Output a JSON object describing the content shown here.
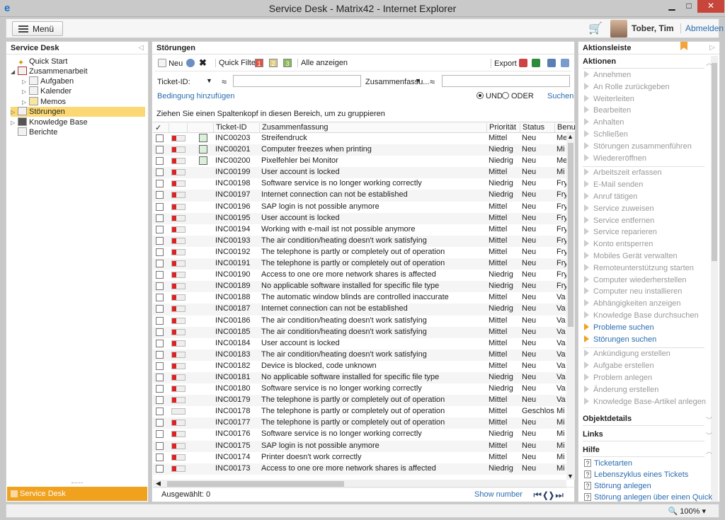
{
  "window": {
    "title": "Service Desk - Matrix42 - Internet Explorer"
  },
  "header": {
    "menu_label": "Menü",
    "user": "Tober, Tim",
    "logout": "Abmelden"
  },
  "left": {
    "title": "Service Desk",
    "tree": [
      "Quick Start",
      "Zusammenarbeit",
      "Aufgaben",
      "Kalender",
      "Memos",
      "Störungen",
      "Knowledge Base",
      "Berichte"
    ],
    "footer": "Service Desk"
  },
  "main": {
    "title": "Störungen",
    "toolbar": {
      "new": "Neu",
      "quick_filter": "Quick Filter",
      "q1": "1",
      "q2": "2",
      "q3": "3",
      "show_all": "Alle anzeigen",
      "export": "Export"
    },
    "filter": {
      "ticket_label": "Ticket-ID:",
      "approx1": "≈",
      "summary_label": "Zusammenfassu...",
      "approx2": "≈",
      "add_condition": "Bedingung hinzufügen",
      "and": "UND",
      "or": "ODER",
      "search": "Suchen"
    },
    "group_hint": "Ziehen Sie einen Spaltenkopf in diesen Bereich, um zu gruppieren",
    "columns": {
      "check": "✓",
      "ticket": "Ticket-ID",
      "summary": "Zusammenfassung",
      "priority": "Priorität",
      "status": "Status",
      "user": "Benut"
    },
    "rows": [
      {
        "id": "INC00203",
        "summary": "Streifendruck",
        "prio": "Mittel",
        "status": "Neu",
        "user": "Me",
        "note": true
      },
      {
        "id": "INC00201",
        "summary": "Computer freezes when printing",
        "prio": "Niedrig",
        "status": "Neu",
        "user": "Mi",
        "note": true
      },
      {
        "id": "INC00200",
        "summary": "Pixelfehler bei Monitor",
        "prio": "Niedrig",
        "status": "Neu",
        "user": "Me",
        "note": true
      },
      {
        "id": "INC00199",
        "summary": "User account is locked",
        "prio": "Mittel",
        "status": "Neu",
        "user": "Mi"
      },
      {
        "id": "INC00198",
        "summary": "Software service is no longer working correctly",
        "prio": "Niedrig",
        "status": "Neu",
        "user": "Fry"
      },
      {
        "id": "INC00197",
        "summary": "Internet connection can not be established",
        "prio": "Niedrig",
        "status": "Neu",
        "user": "Fry"
      },
      {
        "id": "INC00196",
        "summary": "SAP login is not possible anymore",
        "prio": "Mittel",
        "status": "Neu",
        "user": "Fry"
      },
      {
        "id": "INC00195",
        "summary": "User account is locked",
        "prio": "Mittel",
        "status": "Neu",
        "user": "Fry"
      },
      {
        "id": "INC00194",
        "summary": "Working with e-mail ist not possible anymore",
        "prio": "Mittel",
        "status": "Neu",
        "user": "Fry"
      },
      {
        "id": "INC00193",
        "summary": "The air condition/heating doesn't work satisfying",
        "prio": "Mittel",
        "status": "Neu",
        "user": "Fry"
      },
      {
        "id": "INC00192",
        "summary": "The telephone is partly or completely out of operation",
        "prio": "Mittel",
        "status": "Neu",
        "user": "Fry"
      },
      {
        "id": "INC00191",
        "summary": "The telephone is partly or completely out of operation",
        "prio": "Mittel",
        "status": "Neu",
        "user": "Fry"
      },
      {
        "id": "INC00190",
        "summary": "Access to one ore more network shares is affected",
        "prio": "Niedrig",
        "status": "Neu",
        "user": "Fry"
      },
      {
        "id": "INC00189",
        "summary": "No applicable software installed for specific file type",
        "prio": "Niedrig",
        "status": "Neu",
        "user": "Fry"
      },
      {
        "id": "INC00188",
        "summary": "The automatic window blinds are controlled inaccurate",
        "prio": "Mittel",
        "status": "Neu",
        "user": "Va"
      },
      {
        "id": "INC00187",
        "summary": "Internet connection can not be established",
        "prio": "Niedrig",
        "status": "Neu",
        "user": "Va"
      },
      {
        "id": "INC00186",
        "summary": "The air condition/heating doesn't work satisfying",
        "prio": "Mittel",
        "status": "Neu",
        "user": "Va"
      },
      {
        "id": "INC00185",
        "summary": "The air condition/heating doesn't work satisfying",
        "prio": "Mittel",
        "status": "Neu",
        "user": "Va"
      },
      {
        "id": "INC00184",
        "summary": "User account is locked",
        "prio": "Mittel",
        "status": "Neu",
        "user": "Va"
      },
      {
        "id": "INC00183",
        "summary": "The air condition/heating doesn't work satisfying",
        "prio": "Mittel",
        "status": "Neu",
        "user": "Va"
      },
      {
        "id": "INC00182",
        "summary": "Device is blocked, code unknown",
        "prio": "Mittel",
        "status": "Neu",
        "user": "Va"
      },
      {
        "id": "INC00181",
        "summary": "No applicable software installed for specific file type",
        "prio": "Niedrig",
        "status": "Neu",
        "user": "Va"
      },
      {
        "id": "INC00180",
        "summary": "Software service is no longer working correctly",
        "prio": "Niedrig",
        "status": "Neu",
        "user": "Va"
      },
      {
        "id": "INC00179",
        "summary": "The telephone is partly or completely out of operation",
        "prio": "Mittel",
        "status": "Neu",
        "user": "Va"
      },
      {
        "id": "INC00178",
        "summary": "The telephone is partly or completely out of operation",
        "prio": "Mittel",
        "status": "Geschlos...",
        "user": "Mi",
        "grey": true
      },
      {
        "id": "INC00177",
        "summary": "The telephone is partly or completely out of operation",
        "prio": "Mittel",
        "status": "Neu",
        "user": "Mi"
      },
      {
        "id": "INC00176",
        "summary": "Software service is no longer working correctly",
        "prio": "Niedrig",
        "status": "Neu",
        "user": "Mi"
      },
      {
        "id": "INC00175",
        "summary": "SAP login is not possible anymore",
        "prio": "Mittel",
        "status": "Neu",
        "user": "Mi"
      },
      {
        "id": "INC00174",
        "summary": "Printer doesn't work correctly",
        "prio": "Mittel",
        "status": "Neu",
        "user": "Mi"
      },
      {
        "id": "INC00173",
        "summary": "Access to one ore more network shares is affected",
        "prio": "Niedrig",
        "status": "Neu",
        "user": "Mi"
      }
    ],
    "footer": {
      "selected": "Ausgewählt: 0",
      "show_number": "Show number"
    }
  },
  "right": {
    "title": "Aktionsleiste",
    "actions_head": "Aktionen",
    "actions_group1": [
      "Annehmen",
      "An Rolle zurückgeben",
      "Weiterleiten",
      "Bearbeiten",
      "Anhalten",
      "Schließen",
      "Störungen zusammenführen",
      "Wiedereröffnen"
    ],
    "actions_group2": [
      "Arbeitszeit erfassen",
      "E-Mail senden",
      "Anruf tätigen",
      "Service zuweisen",
      "Service entfernen",
      "Service reparieren",
      "Konto entsperren",
      "Mobiles Gerät verwalten",
      "Remoteunterstützung starten",
      "Computer wiederherstellen",
      "Computer neu installieren",
      "Abhängigkeiten anzeigen",
      "Knowledge Base durchsuchen",
      "Probleme suchen",
      "Störungen suchen"
    ],
    "actions_group3": [
      "Ankündigung erstellen",
      "Aufgabe erstellen",
      "Problem anlegen",
      "Änderung erstellen",
      "Knowledge Base-Artikel anlegen"
    ],
    "object_details": "Objektdetails",
    "links": "Links",
    "help_head": "Hilfe",
    "help": [
      "Ticketarten",
      "Lebenszyklus eines Tickets",
      "Störung anlegen",
      "Störung anlegen über einen Quick"
    ]
  },
  "status": {
    "zoom": "100%"
  }
}
